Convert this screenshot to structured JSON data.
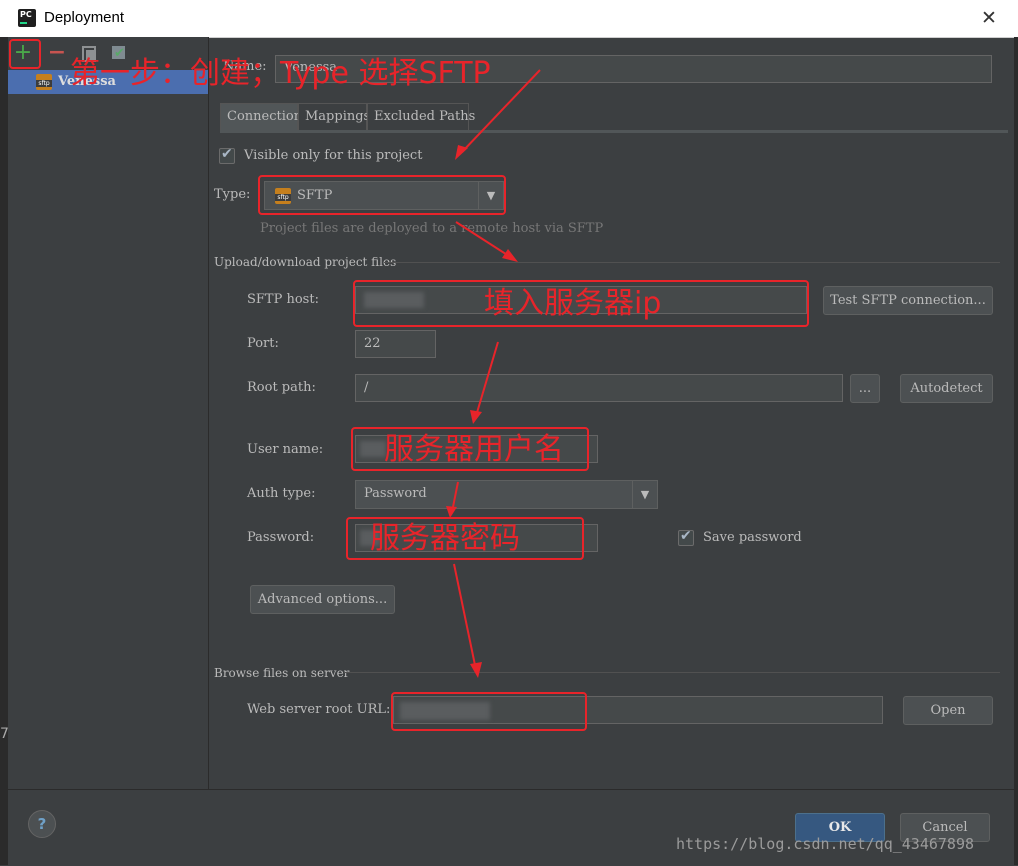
{
  "window": {
    "title": "Deployment",
    "app_icon": "PC"
  },
  "toolbar": {
    "add": "+",
    "remove": "−"
  },
  "servers": [
    {
      "name": "Venessa",
      "icon": "sftp-icon"
    }
  ],
  "name_field": {
    "label": "Name:",
    "value": "Venessa"
  },
  "tabs": [
    {
      "label": "Connection",
      "active": true
    },
    {
      "label": "Mappings"
    },
    {
      "label": "Excluded Paths"
    }
  ],
  "connection": {
    "visible_only": {
      "label": "Visible only for this project",
      "checked": true
    },
    "type": {
      "label": "Type:",
      "value": "SFTP",
      "hint": "Project files are deployed to a remote host via SFTP"
    },
    "upload_section": "Upload/download project files",
    "sftp_host": {
      "label": "SFTP host:",
      "button": "Test SFTP connection..."
    },
    "port": {
      "label": "Port:",
      "value": "22"
    },
    "root_path": {
      "label": "Root path:",
      "value": "/",
      "browse": "...",
      "button": "Autodetect"
    },
    "user_name": {
      "label": "User name:"
    },
    "auth_type": {
      "label": "Auth type:",
      "value": "Password"
    },
    "password": {
      "label": "Password:"
    },
    "save_password": {
      "label": "Save password",
      "checked": true
    },
    "advanced": "Advanced options...",
    "browse_section": "Browse files on server",
    "web_root": {
      "label": "Web server root URL:",
      "button": "Open"
    }
  },
  "footer": {
    "help": "?",
    "ok": "OK",
    "cancel": "Cancel"
  },
  "annotations": {
    "step1": "第一步：创建；Type 选择SFTP",
    "host": "填入服务器ip",
    "user": "服务器用户名",
    "password": "服务器密码"
  },
  "left_edge": {
    "digit": "7"
  },
  "watermark": "https://blog.csdn.net/qq_43467898",
  "colors": {
    "annotation": "#e8242a",
    "selection": "#4b6eaf",
    "ok": "#365880"
  }
}
